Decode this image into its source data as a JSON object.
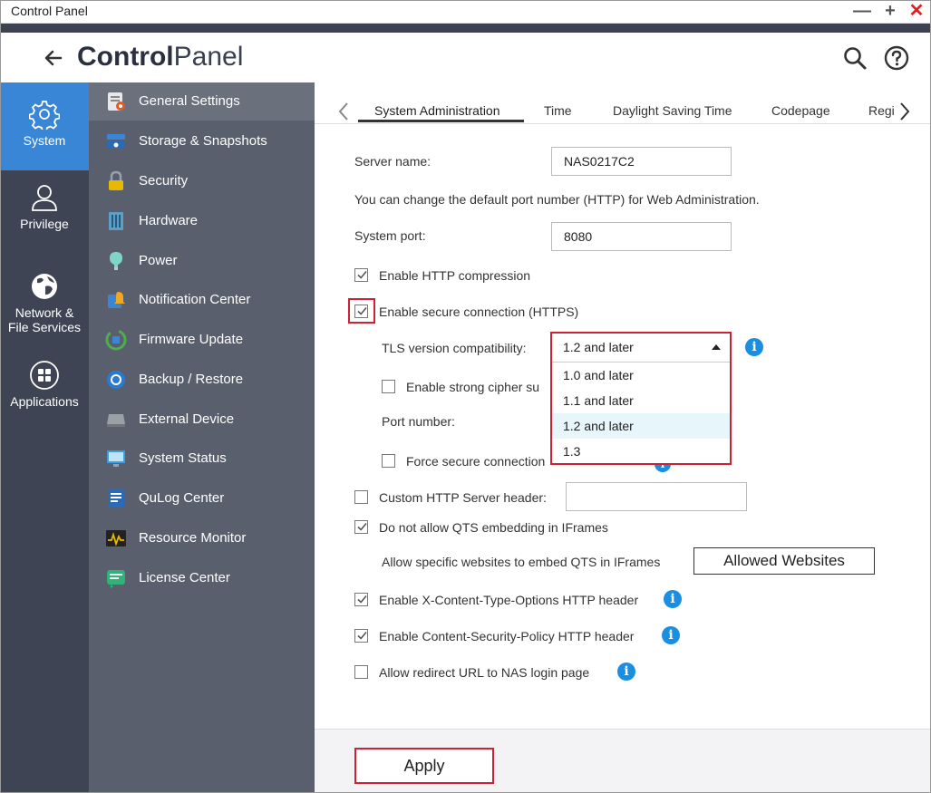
{
  "window": {
    "title": "Control Panel",
    "minimize_label": "—",
    "maximize_label": "+",
    "close_label": "✕"
  },
  "header": {
    "title_bold": "Control",
    "title_light": "Panel"
  },
  "leftnav": {
    "items": [
      {
        "label": "System",
        "icon": "gear-icon",
        "active": true
      },
      {
        "label": "Privilege",
        "icon": "user-icon"
      },
      {
        "label_line1": "Network &",
        "label_line2": "File Services",
        "icon": "globe-icon"
      },
      {
        "label": "Applications",
        "icon": "apps-grid-icon"
      }
    ]
  },
  "submenu": {
    "items": [
      {
        "label": "General Settings",
        "icon": "general-settings-icon",
        "active": true
      },
      {
        "label": "Storage & Snapshots",
        "icon": "storage-icon"
      },
      {
        "label": "Security",
        "icon": "lock-icon"
      },
      {
        "label": "Hardware",
        "icon": "hardware-icon"
      },
      {
        "label": "Power",
        "icon": "power-icon"
      },
      {
        "label": "Notification Center",
        "icon": "notification-icon"
      },
      {
        "label": "Firmware Update",
        "icon": "firmware-update-icon"
      },
      {
        "label": "Backup / Restore",
        "icon": "backup-icon"
      },
      {
        "label": "External Device",
        "icon": "external-device-icon"
      },
      {
        "label": "System Status",
        "icon": "system-status-icon"
      },
      {
        "label": "QuLog Center",
        "icon": "qulog-icon"
      },
      {
        "label": "Resource Monitor",
        "icon": "resource-monitor-icon"
      },
      {
        "label": "License Center",
        "icon": "license-icon"
      }
    ]
  },
  "tabs": [
    {
      "label": "System Administration",
      "active": true
    },
    {
      "label": "Time"
    },
    {
      "label": "Daylight Saving Time"
    },
    {
      "label": "Codepage"
    },
    {
      "label": "Regi"
    }
  ],
  "form": {
    "server_name_label": "Server name:",
    "server_name_value": "NAS0217C2",
    "port_note": "You can change the default port number (HTTP) for Web Administration.",
    "system_port_label": "System port:",
    "system_port_value": "8080",
    "http_compression_label": "Enable HTTP compression",
    "http_compression_checked": true,
    "https_label": "Enable secure connection (HTTPS)",
    "https_checked": true,
    "tls_label": "TLS version compatibility:",
    "tls_selected": "1.2 and later",
    "tls_options": [
      "1.0 and later",
      "1.1 and later",
      "1.2 and later",
      "1.3"
    ],
    "strong_cipher_label": "Enable strong cipher su",
    "strong_cipher_checked": false,
    "port_number_label": "Port number:",
    "force_secure_label": "Force secure connection",
    "force_secure_checked": false,
    "custom_header_label": "Custom HTTP Server header:",
    "custom_header_value": "",
    "custom_header_checked": false,
    "no_iframe_label": "Do not allow QTS embedding in IFrames",
    "no_iframe_checked": true,
    "allow_sites_label": "Allow specific websites to embed QTS in IFrames",
    "allowed_websites_button": "Allowed Websites",
    "x_content_label": "Enable X-Content-Type-Options HTTP header",
    "x_content_checked": true,
    "csp_label": "Enable Content-Security-Policy HTTP header",
    "csp_checked": true,
    "redirect_label": "Allow redirect URL to NAS login page",
    "redirect_checked": false
  },
  "footer": {
    "apply_label": "Apply"
  },
  "colors": {
    "accent": "#3a86d6",
    "highlight_red": "#cc2233",
    "info_blue": "#1a8ee0",
    "nav_dark": "#3f4454",
    "submenu_bg": "#5a5f6d"
  }
}
